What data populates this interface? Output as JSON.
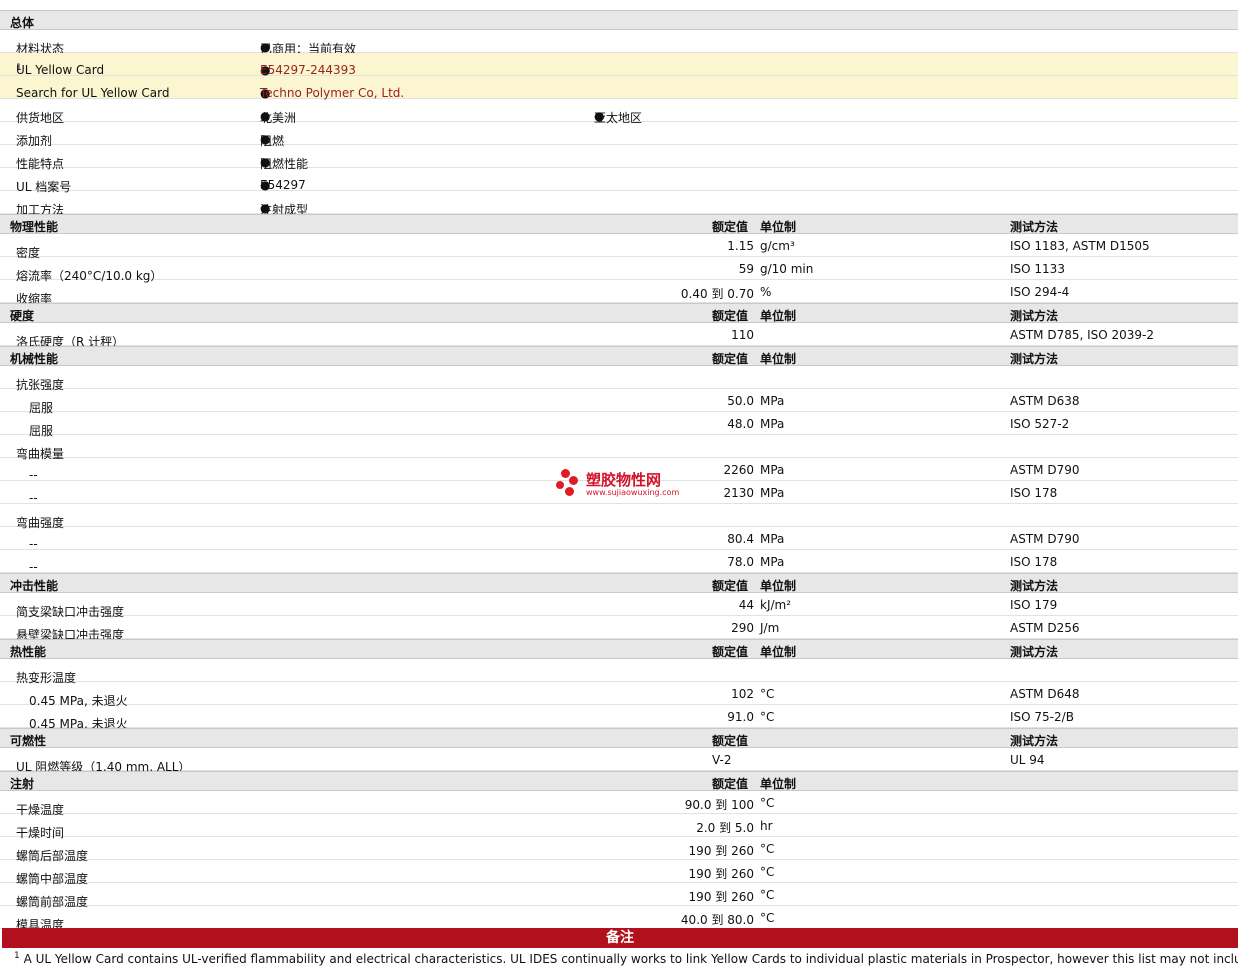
{
  "sections": [
    {
      "title": "总体",
      "headers": null,
      "rows": [
        {
          "name": "材料状态",
          "bullets": [
            "已商用：当前有效"
          ]
        },
        {
          "name": "UL Yellow Card",
          "sup": "1",
          "bullets": [
            "E54297-244393"
          ],
          "highlight": true
        },
        {
          "name": "Search for UL Yellow Card",
          "bullets": [
            "Techno Polymer Co, Ltd."
          ],
          "highlight": true
        },
        {
          "name": "供货地区",
          "bullets": [
            "北美洲",
            "亚太地区"
          ]
        },
        {
          "name": "添加剂",
          "bullets": [
            "阻燃"
          ]
        },
        {
          "name": "性能特点",
          "bullets": [
            "阻燃性能"
          ]
        },
        {
          "name": "UL 档案号",
          "bullets": [
            "E54297"
          ]
        },
        {
          "name": "加工方法",
          "bullets": [
            "注射成型"
          ]
        }
      ]
    },
    {
      "title": "物理性能",
      "headers": {
        "value": "额定值",
        "unit": "单位制",
        "test": "测试方法"
      },
      "rows": [
        {
          "name": "密度",
          "value": "1.15",
          "unit": "g/cm³",
          "test": "ISO 1183, ASTM D1505"
        },
        {
          "name": "熔流率（240°C/10.0 kg）",
          "value": "59",
          "unit": "g/10 min",
          "test": "ISO 1133"
        },
        {
          "name": "收缩率",
          "value": "0.40 到  0.70",
          "unit": "%",
          "test": "ISO 294-4"
        }
      ]
    },
    {
      "title": "硬度",
      "headers": {
        "value": "额定值",
        "unit": "单位制",
        "test": "测试方法"
      },
      "rows": [
        {
          "name": "洛氏硬度（R 计秤）",
          "value": "110",
          "unit": "",
          "test": "ASTM D785, ISO 2039-2"
        }
      ]
    },
    {
      "title": "机械性能",
      "headers": {
        "value": "额定值",
        "unit": "单位制",
        "test": "测试方法"
      },
      "rows": [
        {
          "name": "抗张强度",
          "value": "",
          "unit": "",
          "test": ""
        },
        {
          "name": "屈服",
          "indent": true,
          "value": "50.0",
          "unit": "MPa",
          "test": "ASTM D638"
        },
        {
          "name": "屈服",
          "indent": true,
          "value": "48.0",
          "unit": "MPa",
          "test": "ISO 527-2"
        },
        {
          "name": "弯曲模量",
          "value": "",
          "unit": "",
          "test": ""
        },
        {
          "name": "--",
          "indent": true,
          "value": "2260",
          "unit": "MPa",
          "test": "ASTM D790"
        },
        {
          "name": "--",
          "indent": true,
          "value": "2130",
          "unit": "MPa",
          "test": "ISO 178"
        },
        {
          "name": "弯曲强度",
          "value": "",
          "unit": "",
          "test": ""
        },
        {
          "name": "--",
          "indent": true,
          "value": "80.4",
          "unit": "MPa",
          "test": "ASTM D790"
        },
        {
          "name": "--",
          "indent": true,
          "value": "78.0",
          "unit": "MPa",
          "test": "ISO 178"
        }
      ]
    },
    {
      "title": "冲击性能",
      "headers": {
        "value": "额定值",
        "unit": "单位制",
        "test": "测试方法"
      },
      "rows": [
        {
          "name": "简支梁缺口冲击强度",
          "value": "44",
          "unit": "kJ/m²",
          "test": "ISO 179"
        },
        {
          "name": "悬壁梁缺口冲击强度",
          "value": "290",
          "unit": "J/m",
          "test": "ASTM D256"
        }
      ]
    },
    {
      "title": "热性能",
      "headers": {
        "value": "额定值",
        "unit": "单位制",
        "test": "测试方法"
      },
      "rows": [
        {
          "name": "热变形温度",
          "value": "",
          "unit": "",
          "test": ""
        },
        {
          "name": "0.45 MPa, 未退火",
          "indent": true,
          "value": "102",
          "unit": "°C",
          "test": "ASTM D648"
        },
        {
          "name": "0.45 MPa, 未退火",
          "indent": true,
          "value": "91.0",
          "unit": "°C",
          "test": "ISO 75-2/B"
        }
      ]
    },
    {
      "title": "可燃性",
      "headers": {
        "value": "额定值",
        "unit": "",
        "test": "测试方法"
      },
      "rows": [
        {
          "name": "UL 阻燃等级（1.40 mm, ALL）",
          "hval": "V-2",
          "test": "UL 94"
        }
      ]
    },
    {
      "title": "注射",
      "headers": {
        "value": "额定值",
        "unit": "单位制",
        "test": ""
      },
      "rows": [
        {
          "name": "干燥温度",
          "value": "90.0 到  100",
          "unit": "°C",
          "test": ""
        },
        {
          "name": "干燥时间",
          "value": "2.0 到  5.0",
          "unit": "hr",
          "test": ""
        },
        {
          "name": "螺筒后部温度",
          "value": "190 到  260",
          "unit": "°C",
          "test": ""
        },
        {
          "name": "螺筒中部温度",
          "value": "190 到  260",
          "unit": "°C",
          "test": ""
        },
        {
          "name": "螺筒前部温度",
          "value": "190 到  260",
          "unit": "°C",
          "test": ""
        },
        {
          "name": "模具温度",
          "value": "40.0 到  80.0",
          "unit": "°C",
          "test": ""
        }
      ]
    }
  ],
  "footer": {
    "title": "备注",
    "note_sup": "1",
    "note": "A UL Yellow Card contains UL-verified flammability and electrical characteristics. UL IDES continually works to link Yellow Cards to individual plastic materials in Prospector, however this list may not include all o"
  },
  "watermark": {
    "name": "塑胶物性网",
    "url": "www.sujiaowuxing.com"
  },
  "colors": {
    "section_bg": "#e7e7e7",
    "highlight_bg": "#fbf6cf",
    "link": "#9a2121",
    "footer_bar": "#b0111d",
    "watermark": "#d4132a"
  }
}
